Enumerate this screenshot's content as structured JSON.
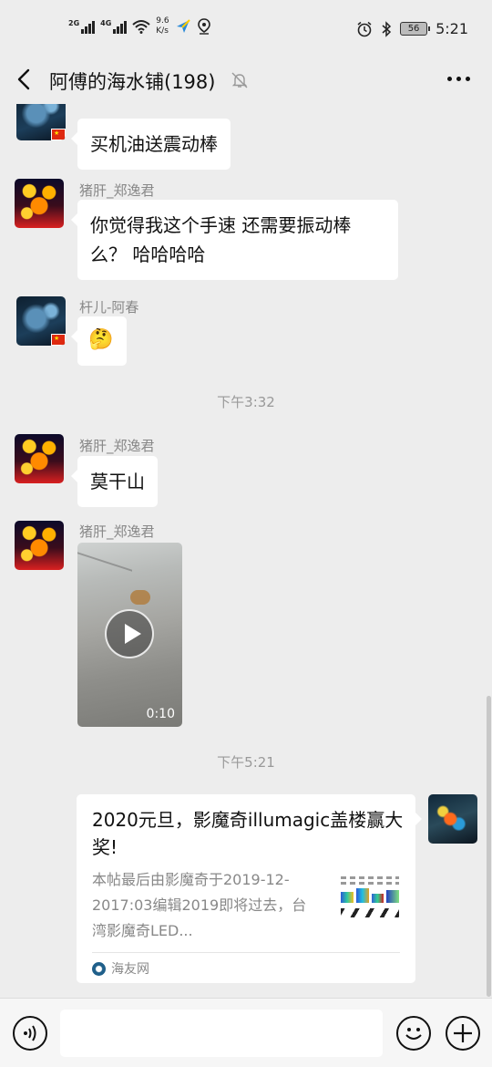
{
  "status_bar": {
    "net_1": "2G",
    "net_2": "4G",
    "speed_value": "9.6",
    "speed_unit": "K/s",
    "battery": "56",
    "time": "5:21"
  },
  "header": {
    "title": "阿傅的海水铺(198)"
  },
  "messages": [
    {
      "sender": "",
      "text": "买机油送震动棒"
    },
    {
      "sender": "猪肝_郑逸君",
      "text": "你觉得我这个手速 还需要振动棒么？ 哈哈哈哈"
    },
    {
      "sender": "杆儿-阿春",
      "text": "🤔"
    },
    {
      "time": "下午3:32"
    },
    {
      "sender": "猪肝_郑逸君",
      "text": "莫干山"
    },
    {
      "sender": "猪肝_郑逸君",
      "video_duration": "0:10"
    },
    {
      "time": "下午5:21"
    }
  ],
  "link_card": {
    "title": "2020元旦，影魔奇illumagic盖楼赢大奖!",
    "desc": "本帖最后由影魔奇于2019-12-2017:03编辑2019即将过去，台湾影魔奇LED...",
    "source": "海友网"
  },
  "colors": {
    "chat_bg": "#ededed",
    "bubble_bg": "#ffffff",
    "secondary_text": "#888888"
  },
  "icons": {
    "back": "back-chevron-icon",
    "mute": "mute-bell-icon",
    "more": "more-dots-icon",
    "voice": "voice-input-icon",
    "emoji": "emoji-icon",
    "plus": "plus-icon"
  }
}
